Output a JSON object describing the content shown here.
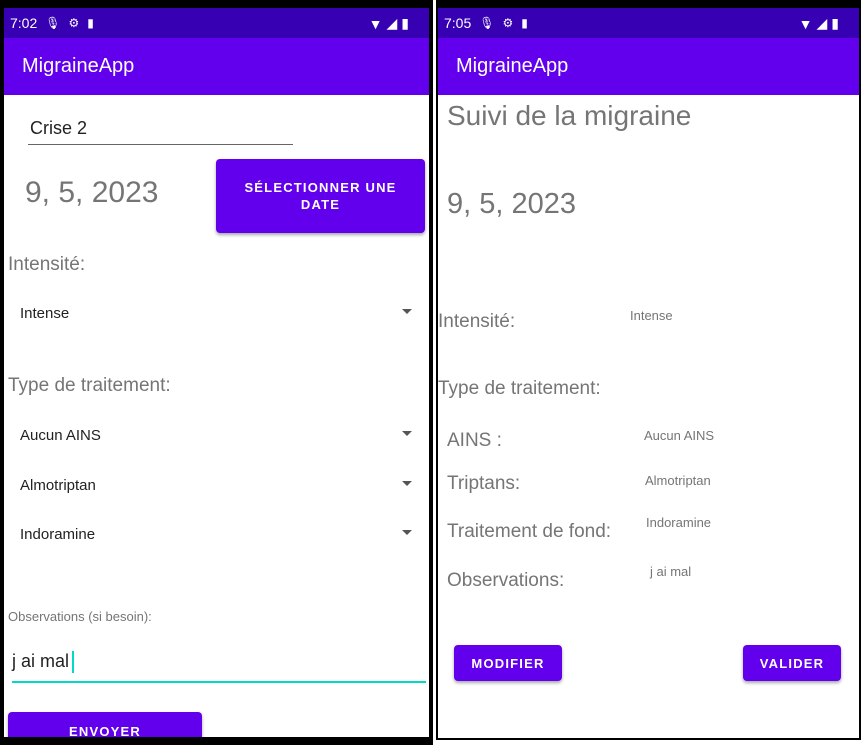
{
  "left": {
    "status_time": "7:02",
    "app_title": "MigraineApp",
    "crisis_name": "Crise 2",
    "date_text": "9, 5, 2023",
    "select_date_label": "SÉLECTIONNER UNE DATE",
    "intensity_label": "Intensité:",
    "intensity_value": "Intense",
    "treatment_label": "Type de traitement:",
    "ains_value": "Aucun AINS",
    "triptan_value": "Almotriptan",
    "fond_value": "Indoramine",
    "observations_label": "Observations (si besoin):",
    "observations_value": "j ai mal",
    "send_label": "ENVOYER"
  },
  "right": {
    "status_time": "7:05",
    "app_title": "MigraineApp",
    "heading": "Suivi de la migraine",
    "date_text": "9, 5, 2023",
    "intensity_label": "Intensité:",
    "intensity_value": "Intense",
    "treatment_label": "Type de traitement:",
    "ains_label": "AINS :",
    "ains_value": "Aucun AINS",
    "triptans_label": "Triptans:",
    "triptans_value": "Almotriptan",
    "fond_label": "Traitement de fond:",
    "fond_value": "Indoramine",
    "observations_label": "Observations:",
    "observations_value": "j ai mal",
    "modify_label": "MODIFIER",
    "validate_label": "VALIDER"
  },
  "colors": {
    "status_bar": "#3700b3",
    "app_bar": "#6200ee",
    "accent": "#03dac5"
  }
}
